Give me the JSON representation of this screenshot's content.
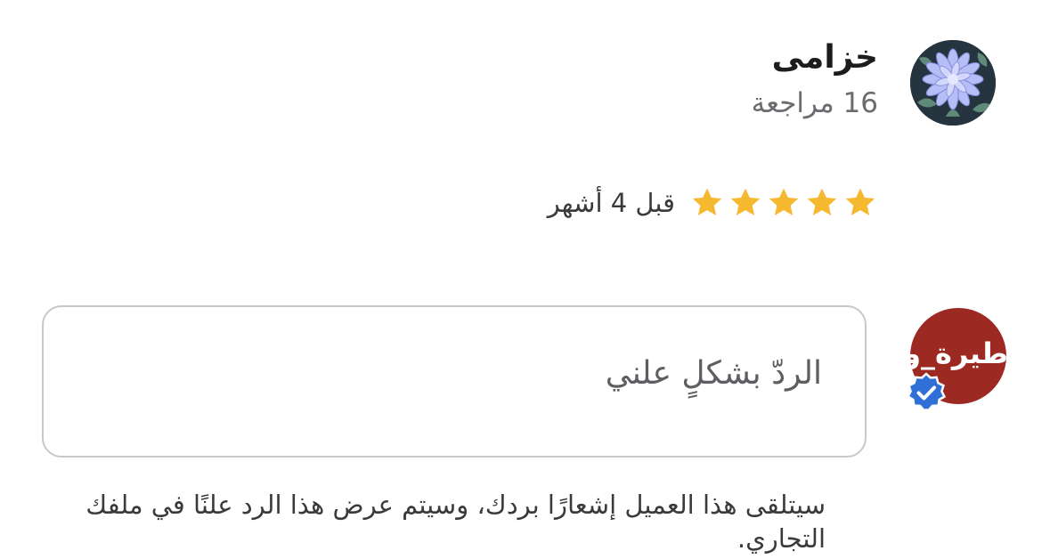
{
  "reviewer": {
    "name": "خزامى",
    "review_count": "16 مراجعة",
    "avatar_icon": "chrysanthemum-flower-avatar"
  },
  "review": {
    "rating": 5,
    "rating_max": 5,
    "time": "قبل 4 أشهر",
    "star_color": "#f5b82e"
  },
  "business": {
    "avatar_text": "طيرة_وذ",
    "avatar_color": "#9d2a22",
    "verified_icon": "verified-badge-icon",
    "verified_color": "#2f6fd6"
  },
  "reply": {
    "placeholder": "الردّ بشكلٍ علني"
  },
  "notice": {
    "text": "سيتلقى هذا العميل إشعارًا بردك، وسيتم عرض هذا الرد علنًا في ملفك التجاري."
  }
}
